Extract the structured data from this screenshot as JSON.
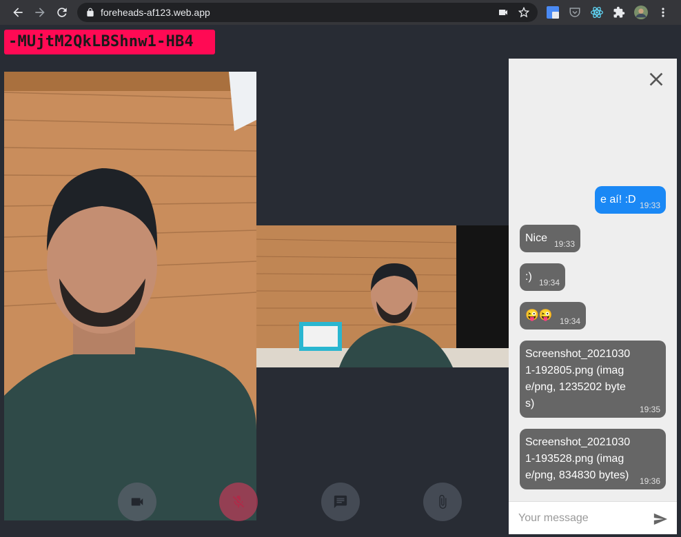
{
  "browser": {
    "url": "foreheads-af123.web.app"
  },
  "room": {
    "id": "-MUjtM2QkLBShnw1-HB4"
  },
  "controls": [
    {
      "name": "camera-toggle-button",
      "icon": "videocam-icon"
    },
    {
      "name": "mic-toggle-button",
      "icon": "mic-off-icon",
      "state": "muted"
    },
    {
      "name": "chat-toggle-button",
      "icon": "chat-icon"
    },
    {
      "name": "attach-file-button",
      "icon": "paperclip-icon"
    }
  ],
  "chat": {
    "messages": [
      {
        "dir": "out",
        "text": "e aí! :D",
        "time": "19:33"
      },
      {
        "dir": "in",
        "text": "Nice",
        "time": "19:33"
      },
      {
        "dir": "in",
        "text": ":)",
        "time": "19:34"
      },
      {
        "dir": "in",
        "text": "😜😜",
        "time": "19:34"
      },
      {
        "dir": "in",
        "lines": [
          "Screenshot_2021030",
          "1-192805.png (imag",
          "e/png, 1235202 byte",
          "s)"
        ],
        "time": "19:35"
      },
      {
        "dir": "in",
        "lines": [
          "Screenshot_2021030",
          "1-193528.png (imag",
          "e/png, 834830 bytes)"
        ],
        "time": "19:36"
      }
    ],
    "input_placeholder": "Your message"
  },
  "colors": {
    "page_bg": "#282c34",
    "room_badge": "#ff0a54",
    "outgoing_bubble": "#1a88f5",
    "incoming_bubble": "#666666",
    "mic_muted": "#e8365d"
  }
}
